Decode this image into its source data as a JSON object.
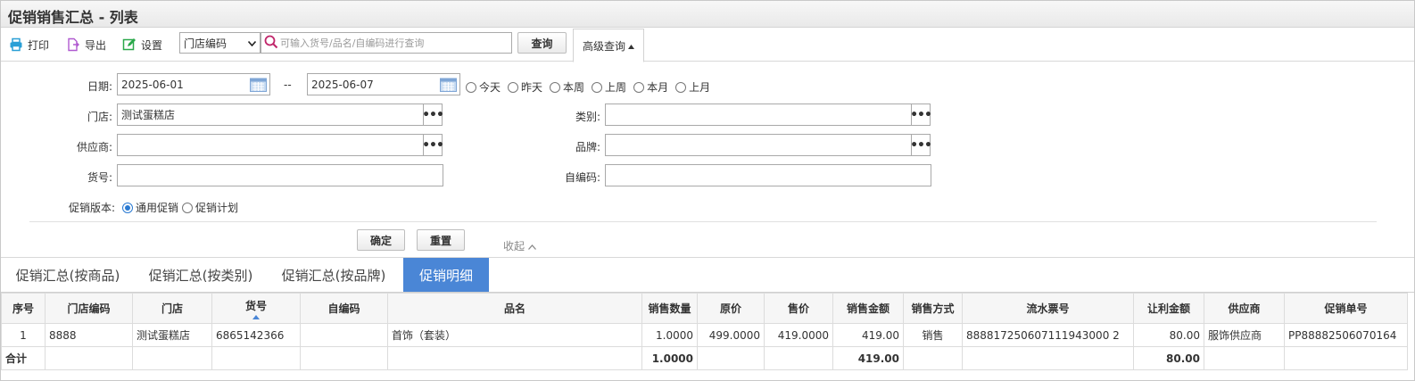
{
  "window": {
    "title": "促销销售汇总 - 列表"
  },
  "toolbar": {
    "print_label": "打印",
    "export_label": "导出",
    "settings_label": "设置",
    "field_select": "门店编码",
    "search_placeholder": "可输入货号/品名/自编码进行查询",
    "query_label": "查询",
    "advanced_label": "高级查询"
  },
  "filters": {
    "date_label": "日期:",
    "date_from": "2025-06-01",
    "date_sep": "--",
    "date_to": "2025-06-07",
    "date_shortcuts": [
      "今天",
      "昨天",
      "本周",
      "上周",
      "本月",
      "上月"
    ],
    "store_label": "门店:",
    "store_value": "测试蛋糕店",
    "category_label": "类别:",
    "category_value": "",
    "supplier_label": "供应商:",
    "supplier_value": "",
    "brand_label": "品牌:",
    "brand_value": "",
    "sku_label": "货号:",
    "sku_value": "",
    "selfcode_label": "自编码:",
    "selfcode_value": "",
    "version_label": "促销版本:",
    "version_options": [
      "通用促销",
      "促销计划"
    ],
    "version_selected": "通用促销",
    "confirm_label": "确定",
    "reset_label": "重置",
    "collapse_label": "收起"
  },
  "tabs": [
    {
      "label": "促销汇总(按商品)",
      "active": false
    },
    {
      "label": "促销汇总(按类别)",
      "active": false
    },
    {
      "label": "促销汇总(按品牌)",
      "active": false
    },
    {
      "label": "促销明细",
      "active": true
    }
  ],
  "table": {
    "columns": [
      "序号",
      "门店编码",
      "门店",
      "货号",
      "自编码",
      "品名",
      "销售数量",
      "原价",
      "售价",
      "销售金额",
      "销售方式",
      "流水票号",
      "让利金额",
      "供应商",
      "促销单号"
    ],
    "sorted_column": "货号",
    "rows": [
      [
        "1",
        "8888",
        "测试蛋糕店",
        "6865142366",
        "",
        "首饰（套装）",
        "1.0000",
        "499.0000",
        "419.0000",
        "419.00",
        "销售",
        "888817250607111943000 2",
        "80.00",
        "服饰供应商",
        "PP88882506070164"
      ]
    ],
    "total": {
      "label": "合计",
      "qty": "1.0000",
      "amount": "419.00",
      "discount": "80.00"
    }
  },
  "colors": {
    "accent": "#4a86d6",
    "print_icon": "#2a9fd6",
    "export_icon": "#b05ad0",
    "settings_icon": "#2aa84a",
    "search_icon": "#c0256a"
  }
}
